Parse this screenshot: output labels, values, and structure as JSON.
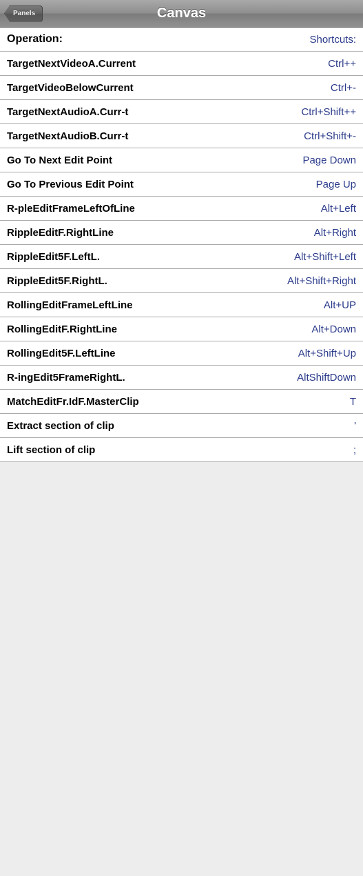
{
  "titlebar": {
    "back_label": "Panels",
    "title": "Canvas"
  },
  "header": {
    "operation_label": "Operation:",
    "shortcuts_label": "Shortcuts:"
  },
  "rows": [
    {
      "operation": "TargetNextVideoA.Current",
      "shortcut": "Ctrl++"
    },
    {
      "operation": "TargetVideoBelowCurrent",
      "shortcut": "Ctrl+-"
    },
    {
      "operation": "TargetNextAudioA.Curr-t",
      "shortcut": "Ctrl+Shift++"
    },
    {
      "operation": "TargetNextAudioB.Curr-t",
      "shortcut": "Ctrl+Shift+-"
    },
    {
      "operation": "Go To Next Edit Point",
      "shortcut": "Page Down"
    },
    {
      "operation": "Go To Previous Edit Point",
      "shortcut": "Page Up"
    },
    {
      "operation": "R-pleEditFrameLeftOfLine",
      "shortcut": "Alt+Left"
    },
    {
      "operation": "RippleEditF.RightLine",
      "shortcut": "Alt+Right"
    },
    {
      "operation": "RippleEdit5F.LeftL.",
      "shortcut": "Alt+Shift+Left"
    },
    {
      "operation": "RippleEdit5F.RightL.",
      "shortcut": "Alt+Shift+Right"
    },
    {
      "operation": "RollingEditFrameLeftLine",
      "shortcut": "Alt+UP"
    },
    {
      "operation": "RollingEditF.RightLine",
      "shortcut": "Alt+Down"
    },
    {
      "operation": "RollingEdit5F.LeftLine",
      "shortcut": "Alt+Shift+Up"
    },
    {
      "operation": "R-ingEdit5FrameRightL.",
      "shortcut": "AltShiftDown"
    },
    {
      "operation": "MatchEditFr.IdF.MasterClip",
      "shortcut": "T"
    },
    {
      "operation": "Extract section of clip",
      "shortcut": "'"
    },
    {
      "operation": "Lift section of clip",
      "shortcut": ";"
    }
  ]
}
